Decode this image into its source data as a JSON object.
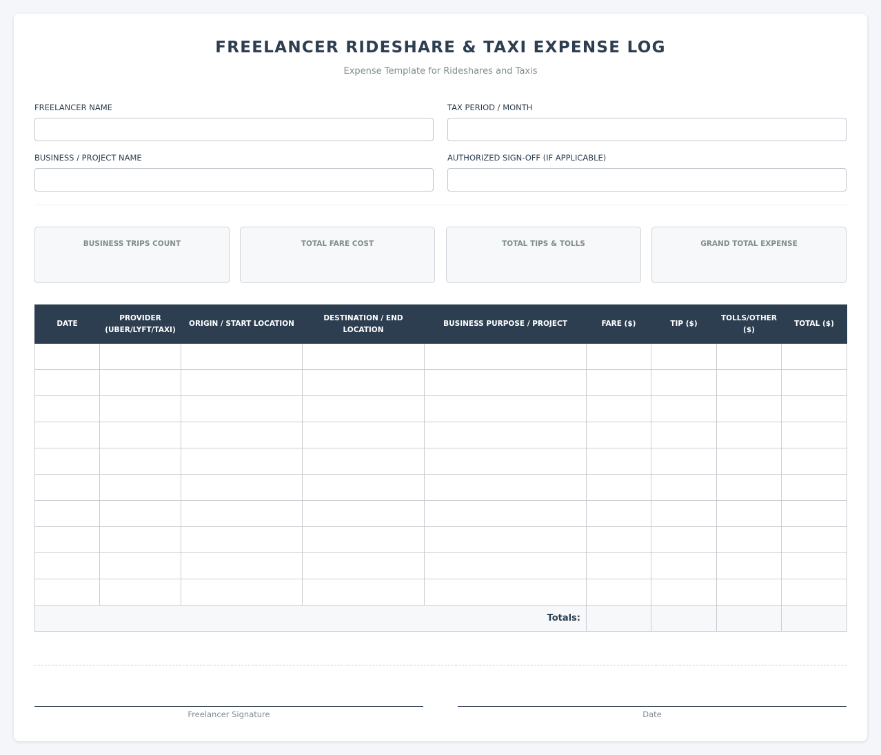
{
  "header": {
    "title": "FREELANCER RIDESHARE & TAXI EXPENSE LOG",
    "subtitle": "Expense Template for Rideshares and Taxis"
  },
  "fields": {
    "freelancer_name": {
      "label": "FREELANCER NAME",
      "value": ""
    },
    "tax_period": {
      "label": "TAX PERIOD / MONTH",
      "value": ""
    },
    "business_name": {
      "label": "BUSINESS / PROJECT NAME",
      "value": ""
    },
    "authorized_signoff": {
      "label": "AUTHORIZED SIGN-OFF (IF APPLICABLE)",
      "value": ""
    }
  },
  "summary": [
    {
      "label": "BUSINESS TRIPS COUNT",
      "value": ""
    },
    {
      "label": "TOTAL FARE COST",
      "value": ""
    },
    {
      "label": "TOTAL TIPS & TOLLS",
      "value": ""
    },
    {
      "label": "GRAND TOTAL EXPENSE",
      "value": ""
    }
  ],
  "table": {
    "headers": [
      "DATE",
      "PROVIDER (UBER/LYFT/TAXI)",
      "ORIGIN / START LOCATION",
      "DESTINATION / END LOCATION",
      "BUSINESS PURPOSE / PROJECT",
      "FARE ($)",
      "TIP ($)",
      "TOLLS/OTHER ($)",
      "TOTAL ($)"
    ],
    "rows": [
      [
        "",
        "",
        "",
        "",
        "",
        "",
        "",
        "",
        ""
      ],
      [
        "",
        "",
        "",
        "",
        "",
        "",
        "",
        "",
        ""
      ],
      [
        "",
        "",
        "",
        "",
        "",
        "",
        "",
        "",
        ""
      ],
      [
        "",
        "",
        "",
        "",
        "",
        "",
        "",
        "",
        ""
      ],
      [
        "",
        "",
        "",
        "",
        "",
        "",
        "",
        "",
        ""
      ],
      [
        "",
        "",
        "",
        "",
        "",
        "",
        "",
        "",
        ""
      ],
      [
        "",
        "",
        "",
        "",
        "",
        "",
        "",
        "",
        ""
      ],
      [
        "",
        "",
        "",
        "",
        "",
        "",
        "",
        "",
        ""
      ],
      [
        "",
        "",
        "",
        "",
        "",
        "",
        "",
        "",
        ""
      ],
      [
        "",
        "",
        "",
        "",
        "",
        "",
        "",
        "",
        ""
      ]
    ],
    "totals_label": "Totals:",
    "totals": [
      "",
      "",
      "",
      ""
    ]
  },
  "signatures": {
    "freelancer": "Freelancer Signature",
    "date": "Date"
  },
  "colors": {
    "header_bg": "#2c3e50",
    "accent_text": "#2c3e50",
    "muted_text": "#7f8c8d",
    "page_bg": "#f4f6f9"
  }
}
